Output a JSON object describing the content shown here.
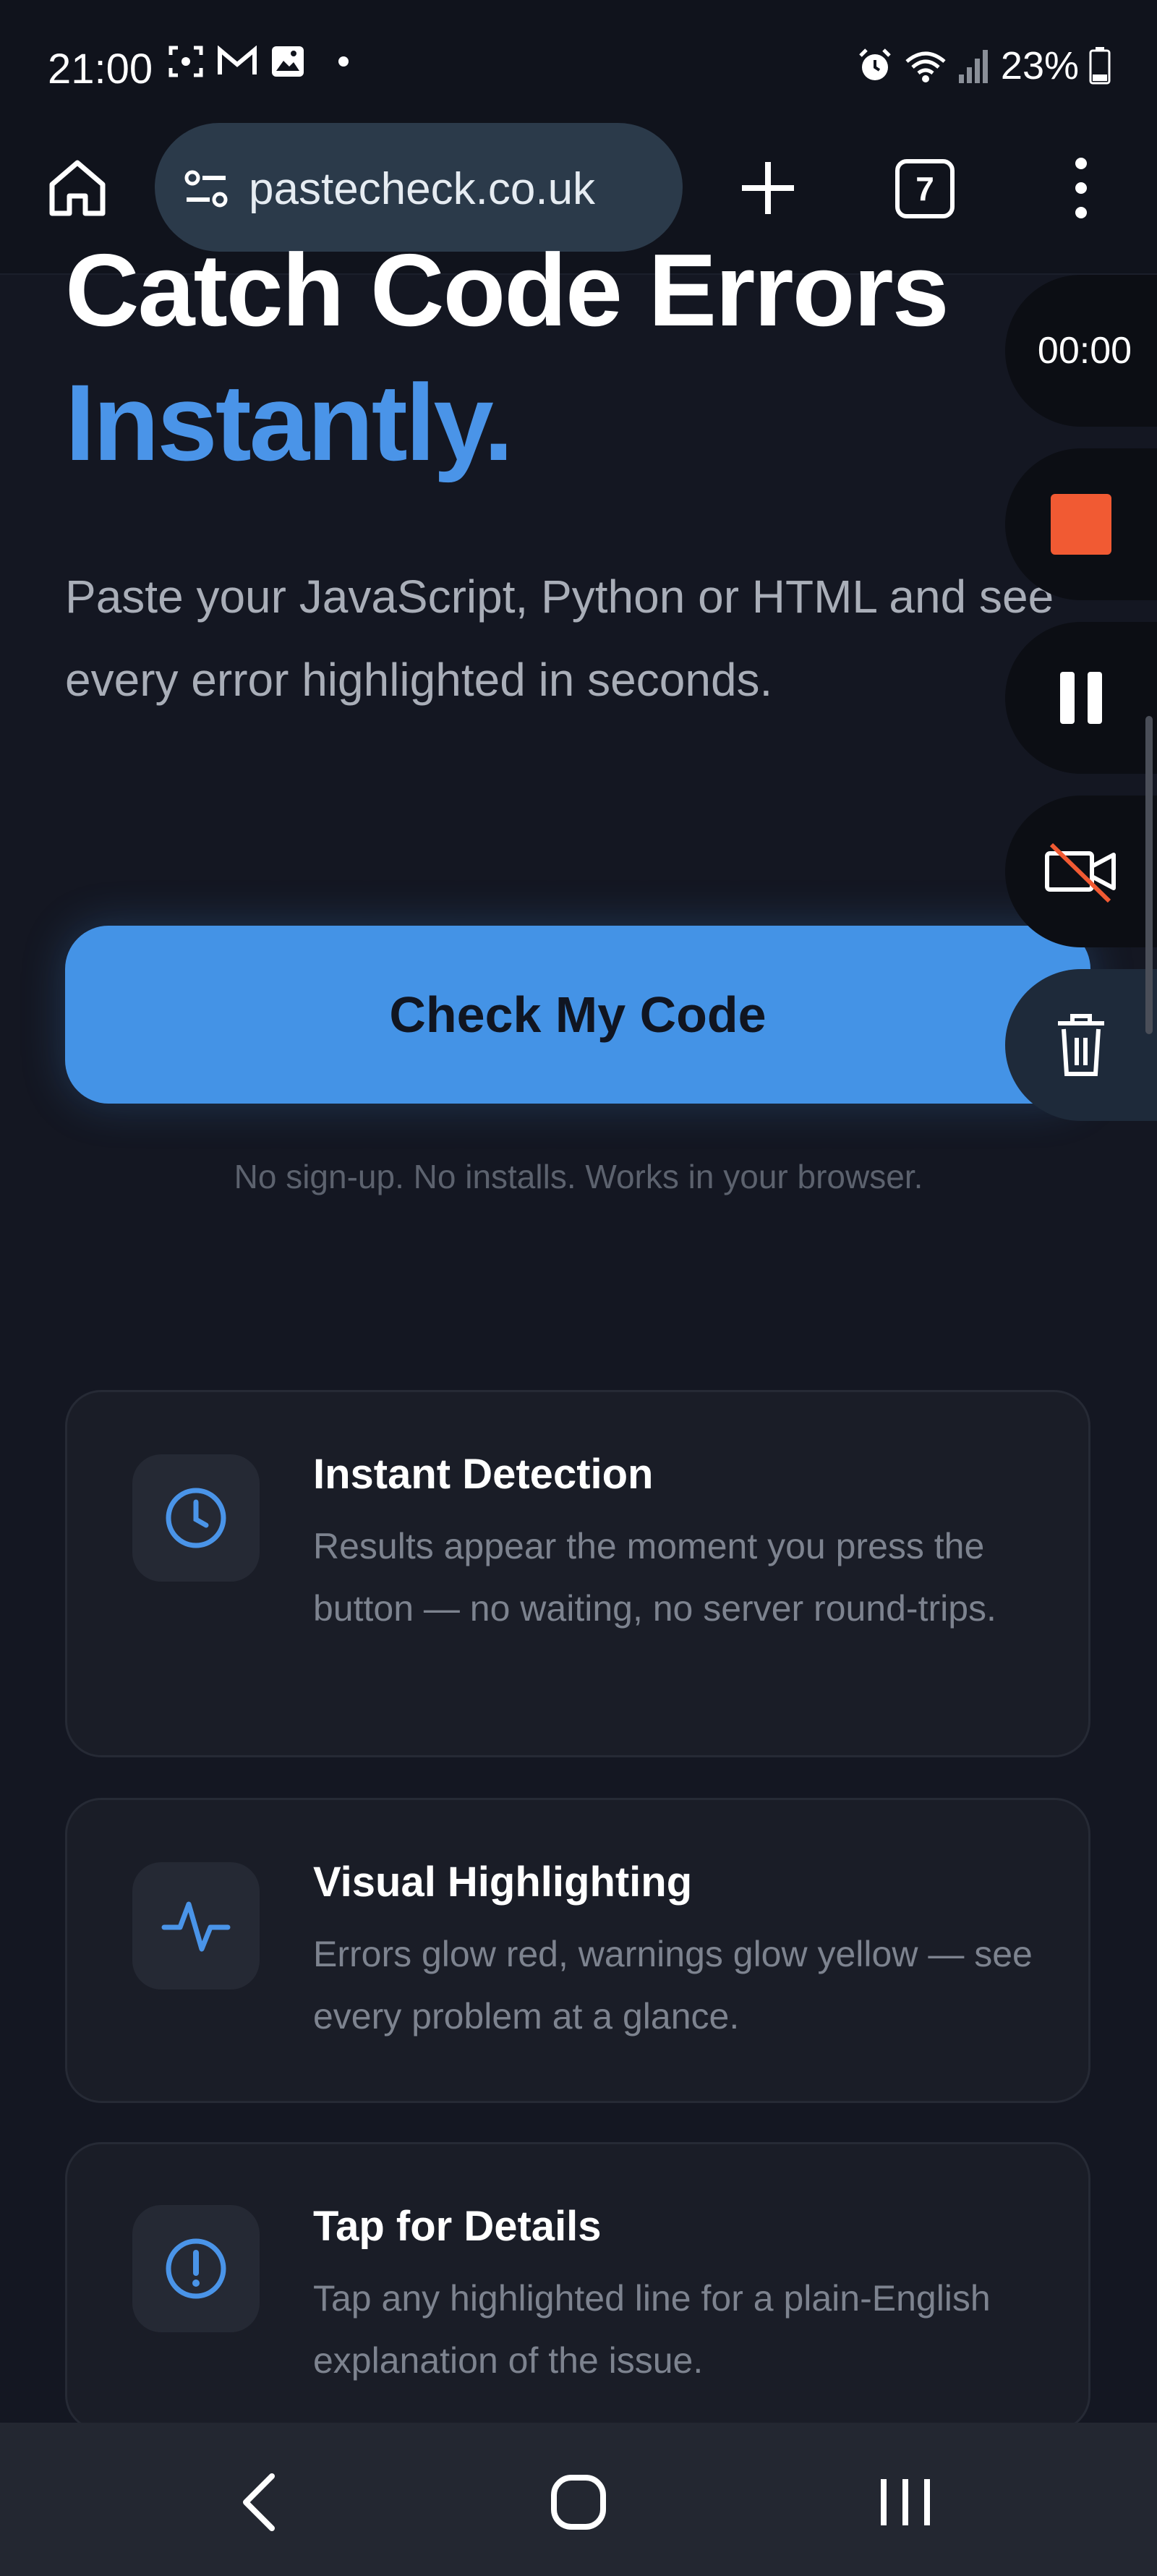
{
  "status_bar": {
    "time": "21:00",
    "battery": "23%",
    "icons": [
      "screenshot-icon",
      "gmail-icon",
      "gallery-icon",
      "alarm-icon",
      "wifi-icon",
      "signal-icon",
      "battery-icon"
    ]
  },
  "toolbar": {
    "url": "pastecheck.co.uk",
    "tab_count": "7"
  },
  "hero": {
    "headline_line1": "Catch Code Errors",
    "headline_line2": "Instantly.",
    "subtitle": "Paste your JavaScript, Python or HTML and see every error highlighted in seconds.",
    "cta_label": "Check My Code",
    "cta_note": "No sign-up. No installs. Works in your browser."
  },
  "features": [
    {
      "title": "Instant Detection",
      "description": "Results appear the moment you press the button — no waiting, no server round-trips.",
      "icon": "clock-icon"
    },
    {
      "title": "Visual Highlighting",
      "description": "Errors glow red, warnings glow yellow — see every problem at a glance.",
      "icon": "pulse-icon"
    },
    {
      "title": "Tap for Details",
      "description": "Tap any highlighted line for a plain-English explanation of the issue.",
      "icon": "alert-circle-icon"
    }
  ],
  "recorder": {
    "timer": "00:00"
  },
  "colors": {
    "accent": "#4493e6",
    "headline_blue": "#4a94e8",
    "record_stop": "#f15a33",
    "background": "#141722"
  }
}
